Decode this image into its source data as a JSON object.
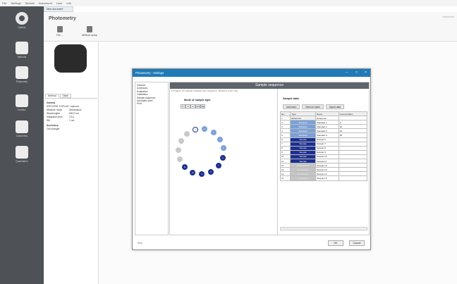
{
  "menu": [
    "File",
    "Settings",
    "Module",
    "Instrument",
    "User",
    "Info"
  ],
  "toolbar": [
    {
      "label": "Options",
      "icon": "gear-icon"
    },
    {
      "label": "Methods",
      "icon": "methods-icon"
    },
    {
      "label": "Photometry",
      "icon": "photometry-icon"
    },
    {
      "label": "Kinetics",
      "icon": "kinetics-icon"
    },
    {
      "label": "Colorimetry",
      "icon": "colorimetry-icon"
    },
    {
      "label": "Quantitation",
      "icon": "quantitation-icon"
    }
  ],
  "doc_tab": "New document",
  "header": {
    "title": "Photometry",
    "file_label": "File ...",
    "method_setup_label": "Method setup",
    "right_text": "Instrument"
  },
  "left_tabs": [
    "Method",
    "Table"
  ],
  "props": {
    "general_heading": "General",
    "instrument": "SPECORD 210PLUS / specord",
    "rows": [
      {
        "k": "Measure mode",
        "v": "Absorbance"
      },
      {
        "k": "Wavelengths",
        "v": "500.0 nm"
      },
      {
        "k": "Integration time",
        "v": "0.5 s"
      },
      {
        "k": "Slit",
        "v": "1 nm"
      }
    ],
    "accessory_heading": "Accessory",
    "accessory": "Cell changer"
  },
  "dialog": {
    "title": "Photometry - Settings",
    "nav": [
      "General",
      "Accessory",
      "Evaluation",
      "Calibration",
      "Sample sequence",
      "Automatic save",
      "Print"
    ],
    "banner": "Sample sequence",
    "instruction": "Configure the sample positions and sequence. Measure order only.",
    "mode_label": "Mode of sample type",
    "mode_buttons": [
      "R",
      "S",
      "Z",
      "Std",
      "Sa"
    ],
    "sample_table_label": "Sample table",
    "add_batch": "Add batch",
    "remove_batch": "Remove batch",
    "import_data": "Import data",
    "columns": [
      "No.",
      "Type",
      "Name",
      "Concentration"
    ],
    "rows": [
      {
        "no": "1",
        "type": "Reference",
        "name": "Reference",
        "conc": ""
      },
      {
        "no": "2",
        "type": "Standard",
        "name": "Standard 1",
        "conc": "0"
      },
      {
        "no": "3",
        "type": "Standard",
        "name": "Standard 2",
        "conc": "20"
      },
      {
        "no": "4",
        "type": "Standard",
        "name": "Standard 3",
        "conc": "40"
      },
      {
        "no": "5",
        "type": "Standard",
        "name": "Standard 4",
        "conc": "60"
      },
      {
        "no": "6",
        "type": "Sample",
        "name": "Sample 6",
        "conc": ""
      },
      {
        "no": "7",
        "type": "Sample",
        "name": "Sample 7",
        "conc": ""
      },
      {
        "no": "8",
        "type": "Sample",
        "name": "Sample 8",
        "conc": ""
      },
      {
        "no": "9",
        "type": "Sample",
        "name": "Sample 9",
        "conc": ""
      },
      {
        "no": "10",
        "type": "Sample",
        "name": "Sample 10",
        "conc": ""
      },
      {
        "no": "11",
        "type": "Sample",
        "name": "Sample 11",
        "conc": ""
      },
      {
        "no": "12",
        "type": "No Measure",
        "name": "Sample 12",
        "conc": ""
      },
      {
        "no": "13",
        "type": "No Measure",
        "name": "Sample 13",
        "conc": ""
      },
      {
        "no": "14",
        "type": "No Measure",
        "name": "Sample 14",
        "conc": ""
      },
      {
        "no": "15",
        "type": "No Measure",
        "name": "Sample 15",
        "conc": ""
      }
    ],
    "help": "Help",
    "ok": "OK",
    "cancel": "Cancel"
  },
  "colors": {
    "titlebar": "#1f7ab8",
    "standard": "#7aa0d8",
    "sample": "#1d2f8f",
    "no_measure": "#c5c5c5",
    "sidebar": "#4e5257"
  }
}
